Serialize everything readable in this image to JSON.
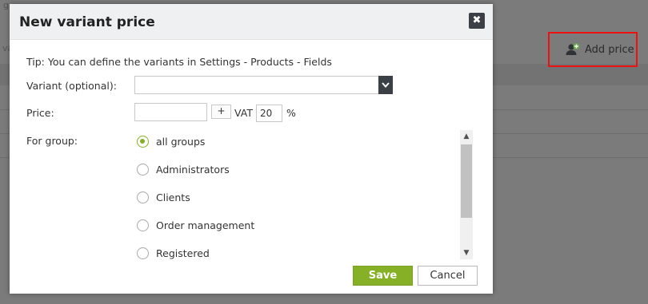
{
  "background": {
    "add_price_label": "Add price",
    "fragment_1": "g",
    "fragment_2": "va"
  },
  "dialog": {
    "title": "New variant price",
    "close_symbol": "✖",
    "tip": "Tip: You can define the variants in Settings - Products - Fields",
    "variant_label": "Variant (optional):",
    "variant_value": "",
    "price_label": "Price:",
    "price_value": "",
    "plus_label": "+",
    "vat_label": "VAT",
    "vat_value": "20",
    "percent_sign": "%",
    "group_label": "For group:",
    "groups": [
      {
        "label": "all groups",
        "checked": true
      },
      {
        "label": "Administrators",
        "checked": false
      },
      {
        "label": "Clients",
        "checked": false
      },
      {
        "label": "Order management",
        "checked": false
      },
      {
        "label": "Registered",
        "checked": false
      }
    ],
    "save_label": "Save",
    "cancel_label": "Cancel"
  },
  "colors": {
    "accent_green": "#86b025",
    "dark_button": "#3a4046",
    "highlight_red": "#ee1111",
    "overlay_gray": "#7b7b7b"
  }
}
